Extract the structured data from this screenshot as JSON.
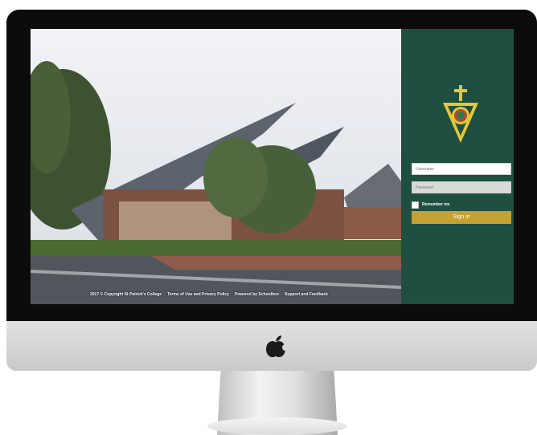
{
  "login": {
    "username_placeholder": "Username",
    "password_placeholder": "Password",
    "remember_label": "Remember me",
    "signin_label": "Sign in"
  },
  "footer": {
    "copyright": "2017 © Copyright St Patrick's College",
    "terms": "Terms of Use and Privacy Policy",
    "powered": "Powered by Schoolbox",
    "support": "Support and Feedback"
  },
  "icons": {
    "crest": "school-crest-icon",
    "device_logo": "apple-logo-icon"
  },
  "colors": {
    "panel": "#1f4f40",
    "button": "#c3a134",
    "crest_gold": "#e3c83a"
  }
}
